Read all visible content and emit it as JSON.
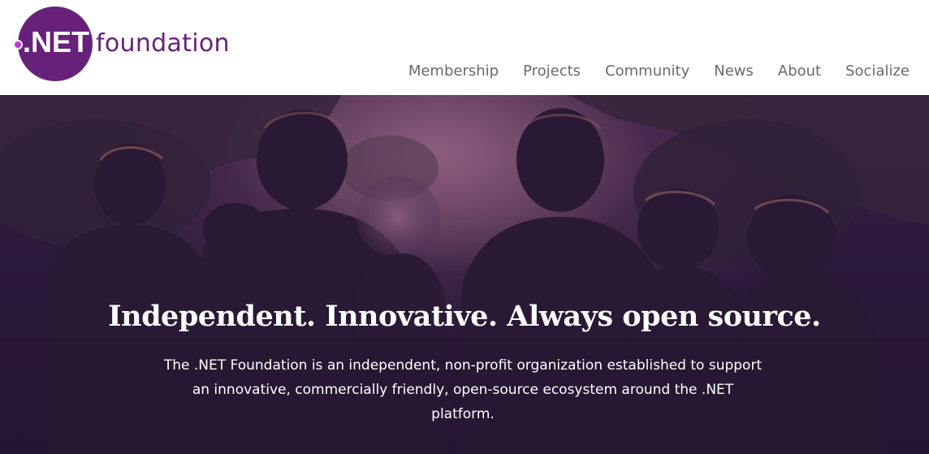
{
  "header": {
    "logo": {
      "mark_text": ".NET",
      "word_text": "foundation",
      "brand_color": "#68217a",
      "dot_color": "#c239d6"
    },
    "nav": [
      {
        "label": "Membership"
      },
      {
        "label": "Projects"
      },
      {
        "label": "Community"
      },
      {
        "label": "News"
      },
      {
        "label": "About"
      },
      {
        "label": "Socialize"
      }
    ]
  },
  "hero": {
    "title": "Independent. Innovative. Always open source.",
    "description": "The .NET Foundation is an independent, non-profit organization established to support an innovative, commercially friendly, open-source ecosystem around the .NET platform."
  }
}
